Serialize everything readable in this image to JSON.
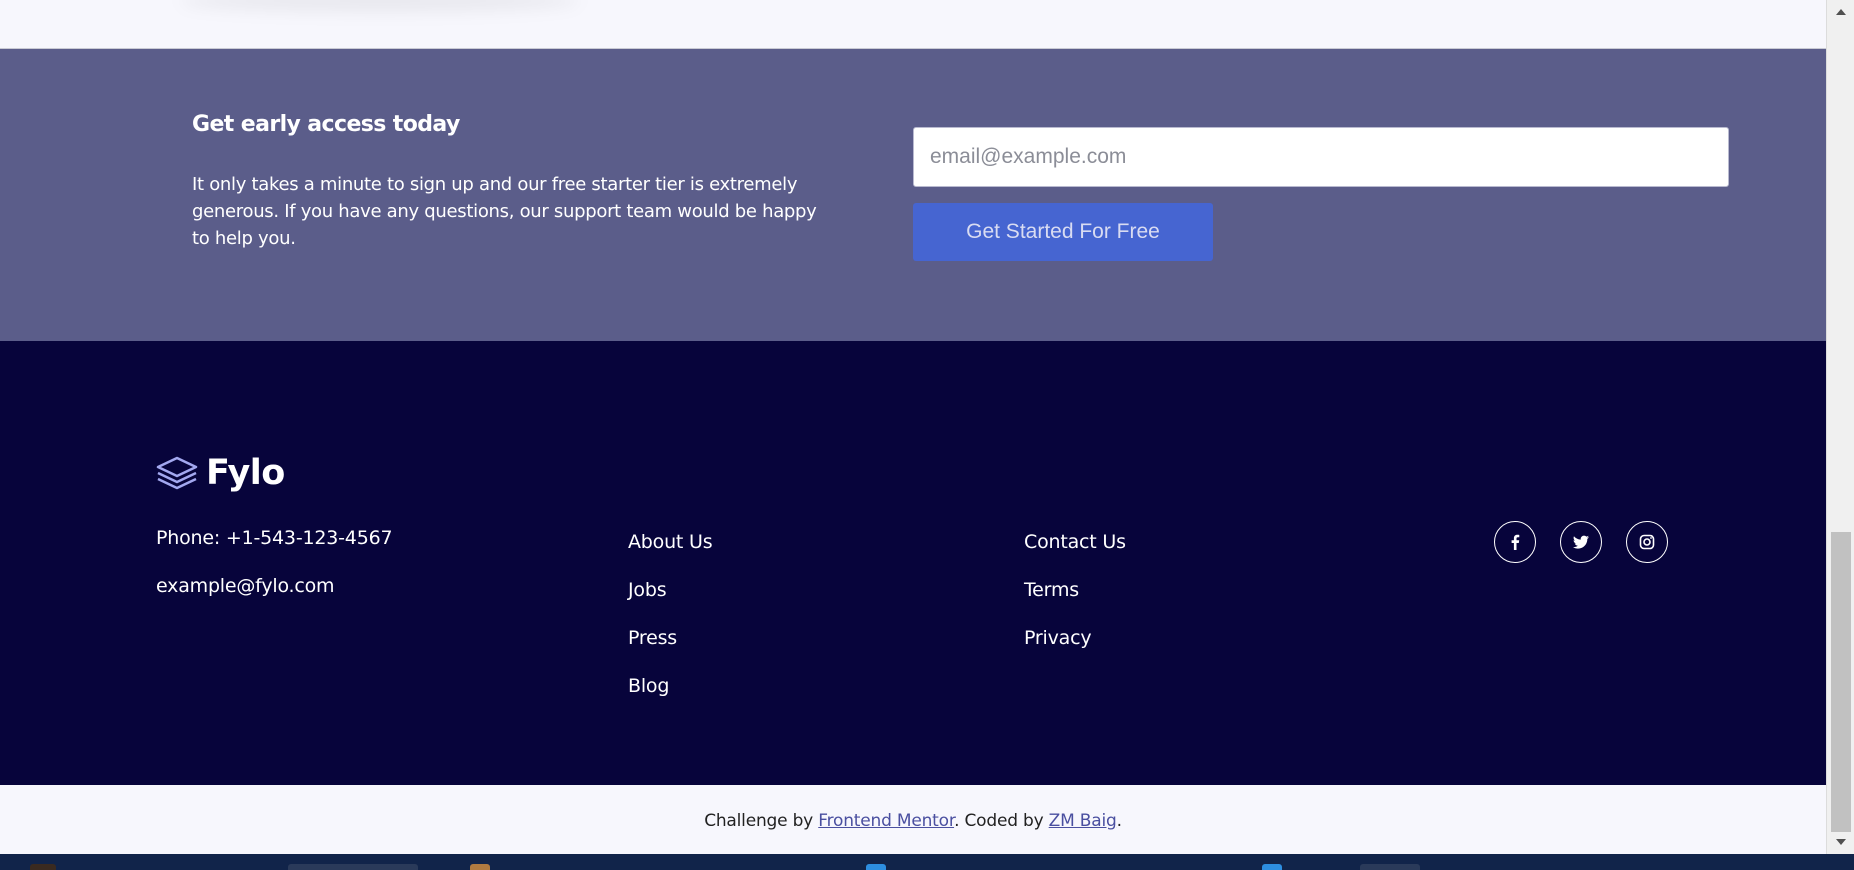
{
  "cta": {
    "title": "Get early access today",
    "text": "It only takes a minute to sign up and our free starter tier is extremely generous. If you have any questions, our support team would be happy to help you.",
    "email_placeholder": "email@example.com",
    "button_label": "Get Started For Free"
  },
  "footer": {
    "brand": "Fylo",
    "phone": "Phone: +1-543-123-4567",
    "email": "example@fylo.com",
    "links_col1": [
      "About Us",
      "Jobs",
      "Press",
      "Blog"
    ],
    "links_col2": [
      "Contact Us",
      "Terms",
      "Privacy"
    ],
    "socials": [
      "facebook-icon",
      "twitter-icon",
      "instagram-icon"
    ]
  },
  "attribution": {
    "prefix": "Challenge by ",
    "link1": "Frontend Mentor",
    "middle": ". Coded by ",
    "link2": "ZM Baig",
    "suffix": "."
  },
  "colors": {
    "cta_bg": "#5b5d8a",
    "footer_bg": "#07043b",
    "button_bg": "#4665d1",
    "page_bg": "#f7f7fd"
  }
}
